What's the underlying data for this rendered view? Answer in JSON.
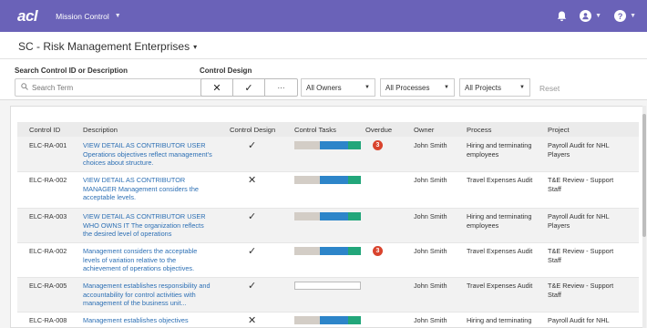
{
  "nav": {
    "logo": "acl",
    "app_menu_label": "Mission Control",
    "icons": [
      "bell-icon",
      "user-icon",
      "help-icon"
    ]
  },
  "header": {
    "title": "SC - Risk Management Enterprises"
  },
  "filters": {
    "search_label": "Search Control ID or Description",
    "search_placeholder": "Search Term",
    "search_value": "",
    "design_label": "Control Design",
    "design_options": [
      "✕",
      "✓",
      "···"
    ],
    "owners": "All Owners",
    "processes": "All Processes",
    "projects": "All Projects",
    "reset_label": "Reset"
  },
  "table": {
    "columns": [
      "Control ID",
      "Description",
      "Control Design",
      "Control Tasks",
      "Overdue",
      "Owner",
      "Process",
      "Project"
    ],
    "rows": [
      {
        "id": "ELC-RA-001",
        "desc": [
          "VIEW DETAIL AS CONTRIBUTOR USER",
          "Operations objectives reflect management's",
          "choices about structure."
        ],
        "design": "✓",
        "tasks": [
          0.38,
          0.43,
          0.19
        ],
        "overdue": "3",
        "owner": "John Smith",
        "process": [
          "Hiring and terminating",
          "employees"
        ],
        "project": [
          "Payroll Audit for NHL",
          "Players"
        ]
      },
      {
        "id": "ELC-RA-002",
        "desc": [
          "VIEW DETAIL AS CONTRIBUTOR",
          "MANAGER Management considers the",
          "acceptable levels."
        ],
        "design": "✕",
        "tasks": [
          0.38,
          0.43,
          0.19
        ],
        "overdue": "",
        "owner": "John Smith",
        "process": [
          "Travel Expenses Audit"
        ],
        "project": [
          "T&E Review - Support",
          "Staff"
        ]
      },
      {
        "id": "ELC-RA-003",
        "desc": [
          "VIEW DETAIL AS CONTRIBUTOR USER",
          "WHO OWNS IT The organization reflects",
          "the desired level of operations"
        ],
        "design": "✓",
        "tasks": [
          0.38,
          0.43,
          0.19
        ],
        "overdue": "",
        "owner": "John Smith",
        "process": [
          "Hiring and terminating",
          "employees"
        ],
        "project": [
          "Payroll Audit for NHL",
          "Players"
        ]
      },
      {
        "id": "ELC-RA-002",
        "desc": [
          "Management considers the acceptable",
          "levels of variation relative to the",
          "achievement of operations objectives."
        ],
        "design": "✓",
        "tasks": [
          0.38,
          0.43,
          0.19
        ],
        "overdue": "3",
        "owner": "John Smith",
        "process": [
          "Travel Expenses Audit"
        ],
        "project": [
          "T&E Review - Support",
          "Staff"
        ]
      },
      {
        "id": "ELC-RA-005",
        "desc": [
          "Management establishes responsibility and",
          "accountability for control activities with",
          "management of the business unit..."
        ],
        "design": "✓",
        "tasks": [],
        "overdue": "",
        "owner": "John Smith",
        "process": [
          "Travel Expenses Audit"
        ],
        "project": [
          "T&E Review - Support",
          "Staff"
        ]
      },
      {
        "id": "ELC-RA-008",
        "desc": [
          "Management establishes objectives"
        ],
        "design": "✕",
        "tasks": [
          0.38,
          0.43,
          0.19
        ],
        "overdue": "",
        "owner": "John Smith",
        "process": [
          "Hiring and terminating"
        ],
        "project": [
          "Payroll Audit for NHL"
        ]
      }
    ]
  },
  "colors": {
    "nav": "#6a62b8",
    "task_grey": "#d3cdc6",
    "task_blue": "#2d85c9",
    "task_green": "#22a67a",
    "badge": "#d9432d",
    "link": "#2c6fb4"
  }
}
